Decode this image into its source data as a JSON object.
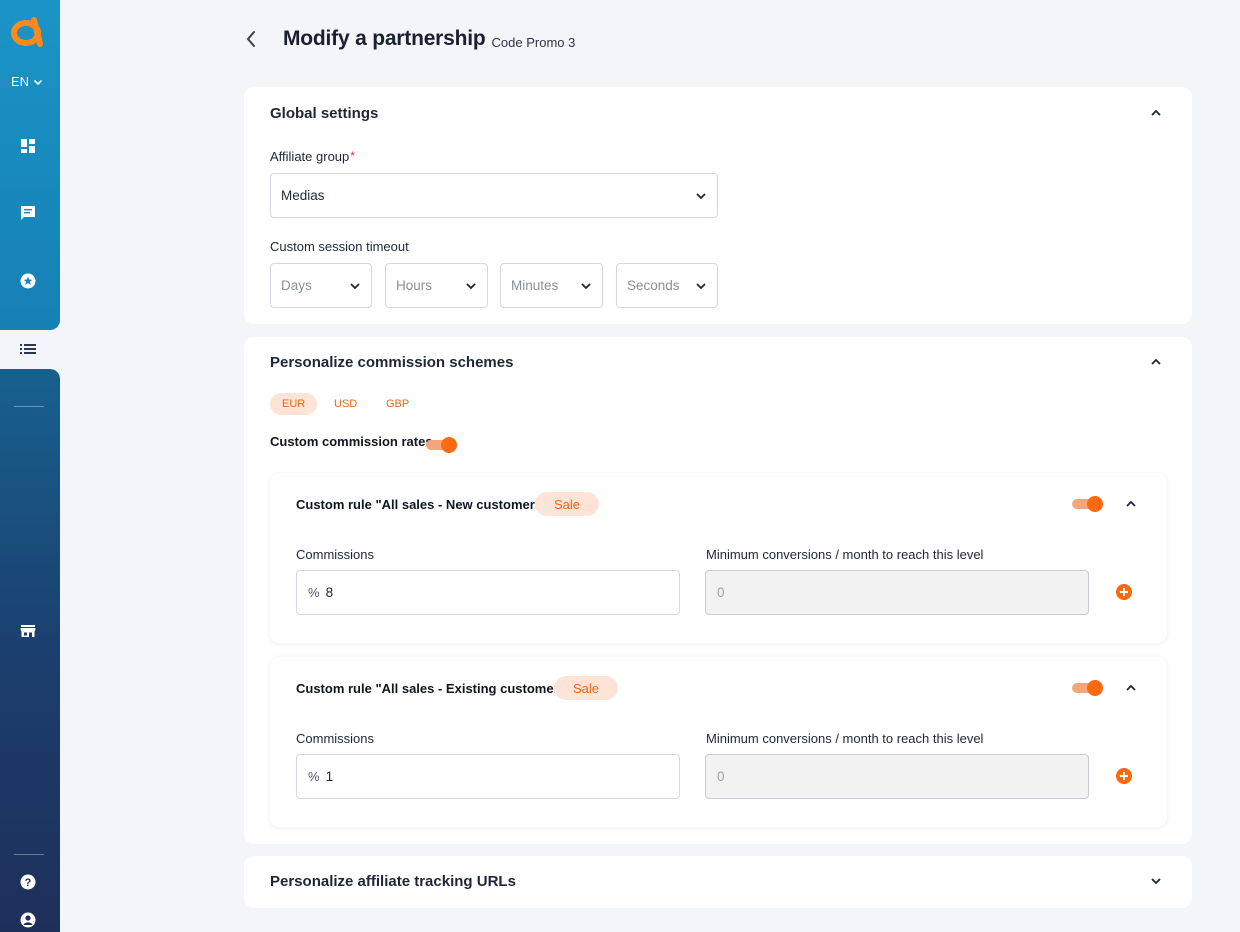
{
  "sidebar": {
    "lang": "EN",
    "icons": [
      "dashboard-icon",
      "messages-icon",
      "star-badge-icon",
      "list-icon",
      "store-icon",
      "help-icon",
      "account-icon"
    ]
  },
  "header": {
    "title": "Modify a partnership",
    "subtitle": "Code Promo 3"
  },
  "global": {
    "title": "Global settings",
    "affiliate_group_label": "Affiliate group",
    "required_mark": "*",
    "affiliate_group_value": "Medias",
    "timeout_label": "Custom session timeout",
    "timeout": {
      "days": "Days",
      "hours": "Hours",
      "minutes": "Minutes",
      "seconds": "Seconds"
    }
  },
  "commission": {
    "title": "Personalize commission schemes",
    "currencies": [
      "EUR",
      "USD",
      "GBP"
    ],
    "active_currency": "EUR",
    "custom_rates_label": "Custom commission rates",
    "custom_rates_enabled": true,
    "rules": [
      {
        "title": "Custom rule \"All sales - New customers\"",
        "badge": "Sale",
        "enabled": true,
        "commissions_label": "Commissions",
        "unit": "%",
        "commission_value": "8",
        "min_label": "Minimum conversions / month to reach this level",
        "min_value": "0"
      },
      {
        "title": "Custom rule \"All sales - Existing customers\"",
        "badge": "Sale",
        "enabled": true,
        "commissions_label": "Commissions",
        "unit": "%",
        "commission_value": "1",
        "min_label": "Minimum conversions / month to reach this level",
        "min_value": "0"
      }
    ]
  },
  "tracking": {
    "title": "Personalize affiliate tracking URLs"
  },
  "colors": {
    "accent": "#ff6a10",
    "sidebar_top": "#1a94c6",
    "sidebar_bottom": "#1e2f5a"
  }
}
